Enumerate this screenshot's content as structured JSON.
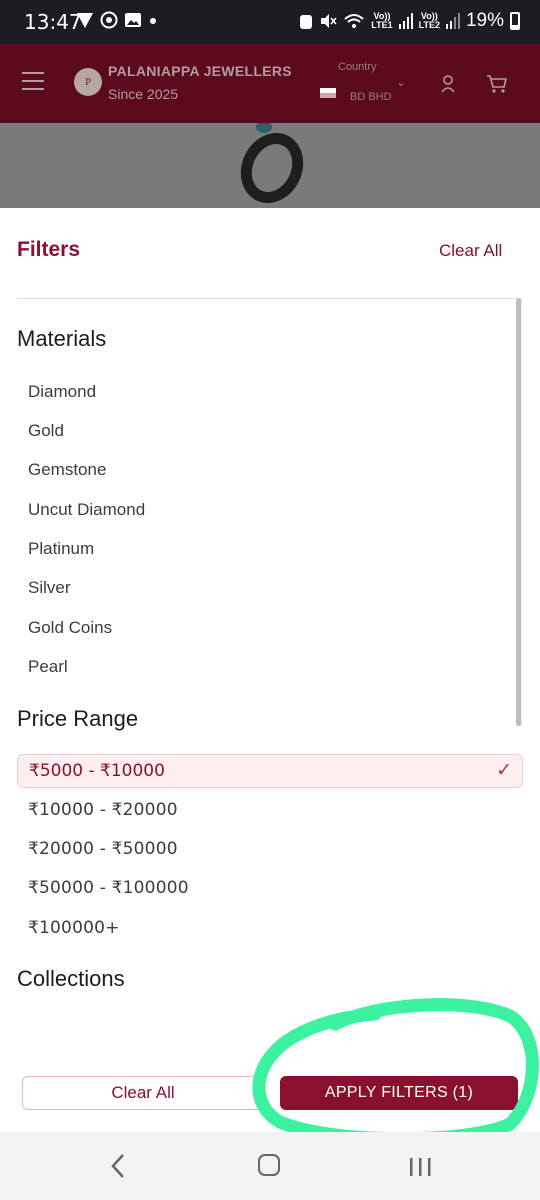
{
  "status_bar": {
    "time": "13:47",
    "battery": "19%",
    "sim1": "Vo))\nLTE1",
    "sim2": "Vo))\nLTE2"
  },
  "header": {
    "brand": "PALANIAPPA JEWELLERS",
    "since": "Since 2025",
    "country_label": "Country",
    "country_value": "BD BHD",
    "logo_text": "P"
  },
  "filters": {
    "title": "Filters",
    "clear_all_top": "Clear All",
    "materials": {
      "title": "Materials",
      "options": [
        "Diamond",
        "Gold",
        "Gemstone",
        "Uncut Diamond",
        "Platinum",
        "Silver",
        "Gold Coins",
        "Pearl"
      ]
    },
    "price_range": {
      "title": "Price Range",
      "selected": "₹5000 - ₹10000",
      "options": [
        "₹10000 - ₹20000",
        "₹20000 - ₹50000",
        "₹50000 - ₹100000",
        "₹100000+"
      ]
    },
    "collections": {
      "title": "Collections"
    },
    "clear_all_bottom": "Clear All",
    "apply_label": "APPLY FILTERS (1)"
  },
  "colors": {
    "accent": "#8a1030",
    "annotation": "#3cf2a0"
  },
  "icons": [
    "wifi-icon",
    "signal-icon",
    "battery-icon",
    "menu-icon",
    "user-icon",
    "cart-icon",
    "check-icon",
    "back-icon",
    "home-icon",
    "recents-icon"
  ]
}
